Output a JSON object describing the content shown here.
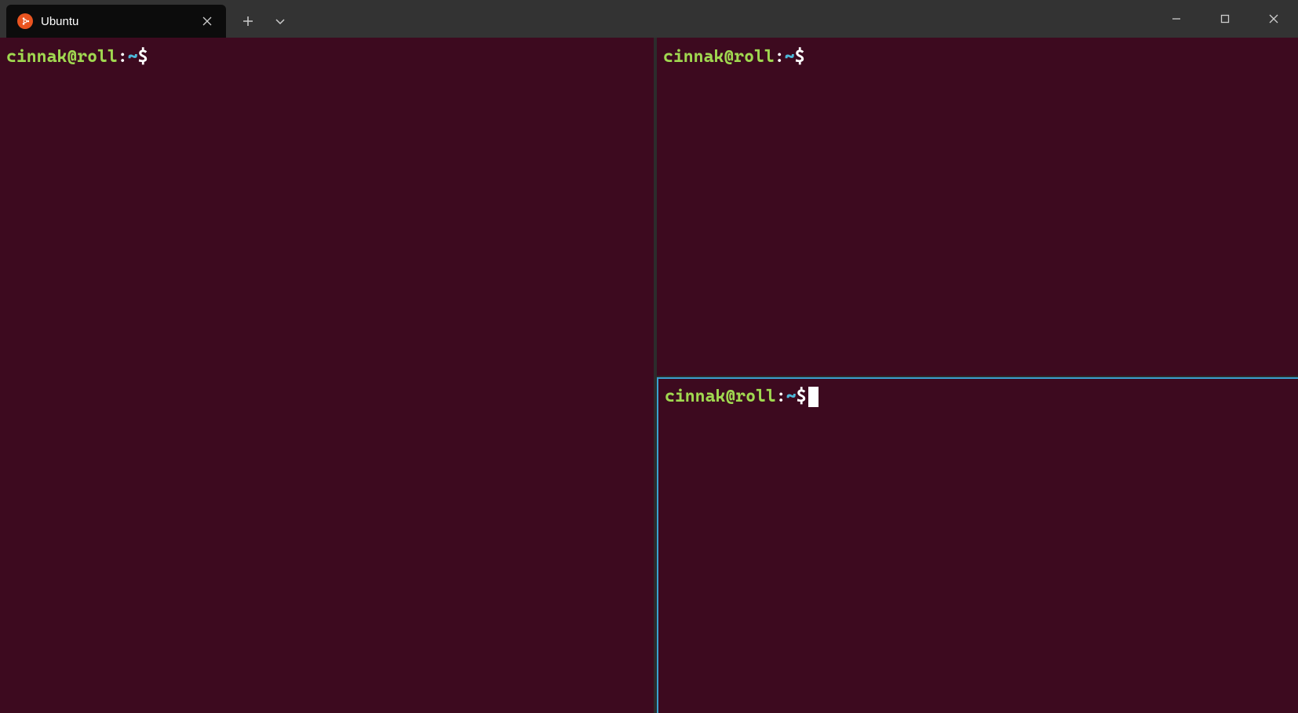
{
  "titlebar": {
    "tab_title": "Ubuntu"
  },
  "prompts": {
    "user_host": "cinnak@roll",
    "colon": ":",
    "path": "~",
    "dollar": "$ "
  },
  "colors": {
    "terminal_bg": "#3d0a1f",
    "active_border": "#3ba0d0",
    "prompt_green": "#a0d850",
    "prompt_blue": "#4db8d8",
    "titlebar_bg": "#333333"
  }
}
